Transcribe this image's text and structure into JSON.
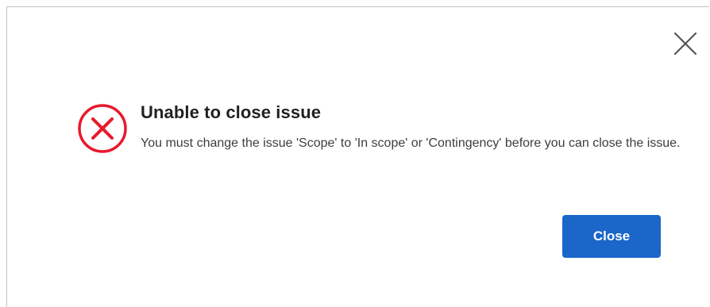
{
  "dialog": {
    "title": "Unable to close issue",
    "message": "You must change the issue 'Scope' to 'In scope' or 'Contingency' before you can close the issue.",
    "status_icon": "error-circle-x-icon",
    "dismiss_icon": "close-icon",
    "close_button_label": "Close"
  },
  "colors": {
    "error": "#e8192c",
    "primary_button": "#1a66c9",
    "title_text": "#212121",
    "body_text": "#3d3d3d"
  }
}
